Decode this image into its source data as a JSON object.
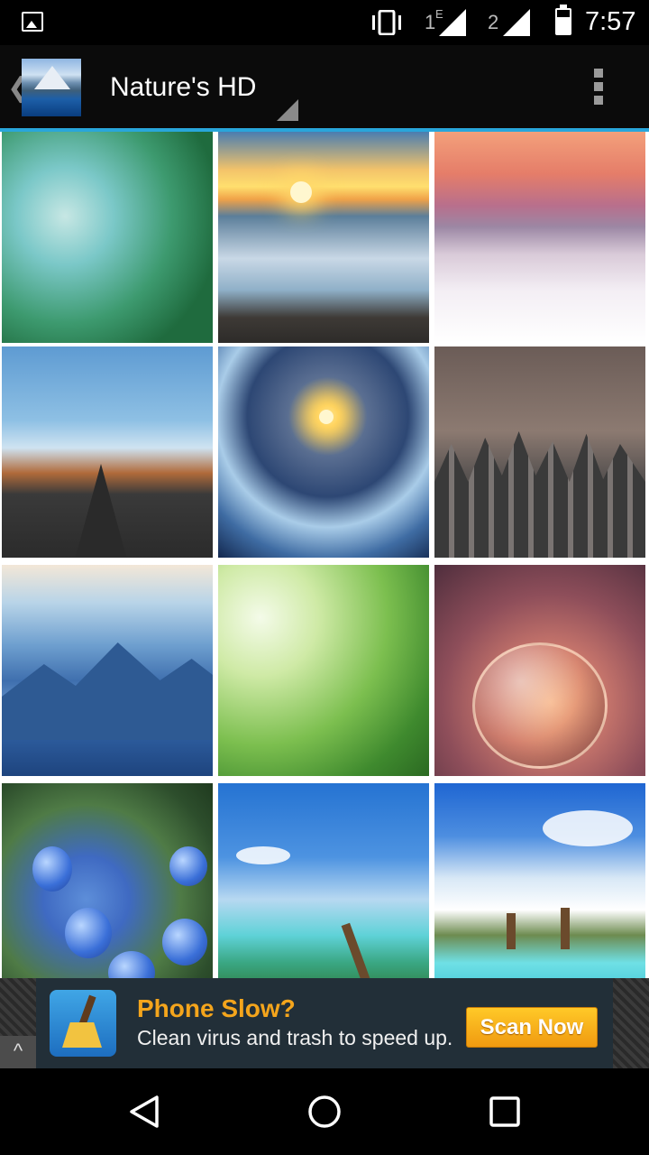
{
  "status_bar": {
    "sim1_label": "1",
    "sim1_network": "E",
    "sim2_label": "2",
    "time": "7:57",
    "icons": [
      "gallery-icon",
      "vibrate-icon",
      "signal-icon",
      "signal-icon",
      "battery-icon"
    ]
  },
  "action_bar": {
    "title": "Nature's HD",
    "icons": [
      "back-chevron-icon",
      "app-icon",
      "dropdown-triangle-icon",
      "overflow-menu-icon"
    ]
  },
  "gallery": {
    "tiles": [
      "Green plant close-up",
      "Sunset over sea and rocks",
      "Snowy cabins under pink sky",
      "Road to mountains",
      "Sunburst over icy lagoon",
      "Snow-covered pine forest",
      "Blue mountain layers",
      "Green leaves in light",
      "Seedling in glass bubble",
      "Blue juniper berries",
      "Tropical beach with palm",
      "Palm island and lagoon"
    ]
  },
  "ad": {
    "headline": "Phone Slow?",
    "subline": "Clean virus and trash to speed up.",
    "cta_label": "Scan Now",
    "collapse_glyph": "^",
    "accent_color": "#f4a51c"
  },
  "nav_bar": {
    "icons": [
      "back-triangle-icon",
      "home-circle-icon",
      "recents-square-icon"
    ]
  },
  "colors": {
    "accent_line": "#29a6db",
    "status_bar": "#000000",
    "action_bar": "#0b0b0b"
  }
}
